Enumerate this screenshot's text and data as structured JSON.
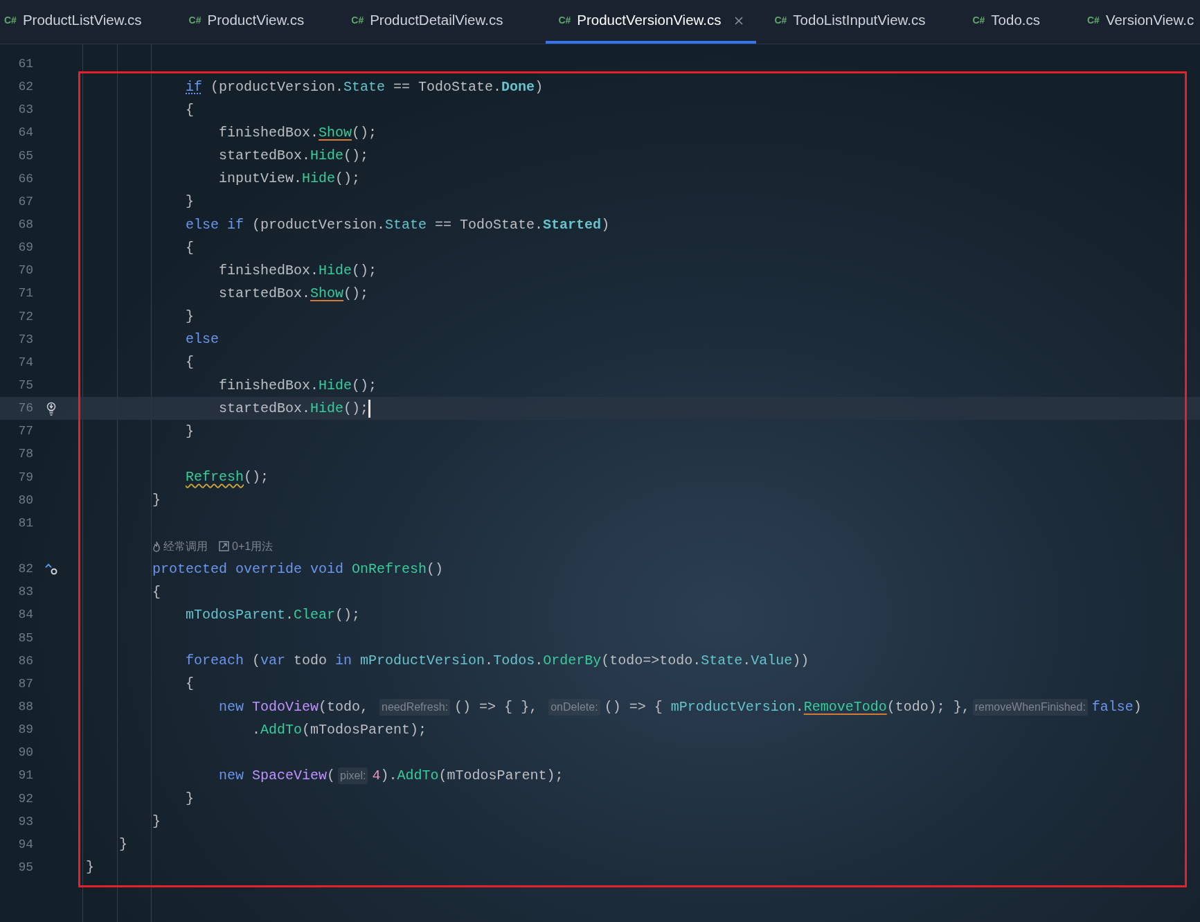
{
  "tabs": [
    {
      "lang": "C#",
      "label": "ProductListView.cs",
      "selected": false
    },
    {
      "lang": "C#",
      "label": "ProductView.cs",
      "selected": false
    },
    {
      "lang": "C#",
      "label": "ProductDetailView.cs",
      "selected": false
    },
    {
      "lang": "C#",
      "label": "ProductVersionView.cs",
      "selected": true
    },
    {
      "lang": "C#",
      "label": "TodoListInputView.cs",
      "selected": false
    },
    {
      "lang": "C#",
      "label": "Todo.cs",
      "selected": false
    },
    {
      "lang": "C#",
      "label": "VersionView.c",
      "selected": false
    }
  ],
  "annotation": {
    "kind": "rectangle"
  },
  "lines": [
    {
      "kind": "group",
      "children": [
        {
          "kind": "group",
          "children": [
            {
              "kind": "group",
              "children": [
                {
                  "kind": "code",
                  "number": "61",
                  "current": false,
                  "boxed": false
                },
                {
                  "kind": "code",
                  "number": "62",
                  "current": false,
                  "boxed": true,
                  "tokens": [
                    {
                      "kind": "keyword_dotted",
                      "text": "if"
                    },
                    {
                      "kind": "plain",
                      "text": " (productVersion."
                    },
                    {
                      "kind": "field",
                      "text": "State"
                    },
                    {
                      "kind": "plain",
                      "text": " == TodoState."
                    },
                    {
                      "kind": "enum",
                      "text": "Done"
                    },
                    {
                      "kind": "plain",
                      "text": ")"
                    }
                  ]
                },
                {
                  "kind": "code",
                  "number": "63",
                  "current": false,
                  "boxed": true,
                  "tokens": [
                    {
                      "kind": "plain",
                      "text": "{"
                    }
                  ],
                  "children": [
                    {
                      "kind": "code",
                      "number": "64",
                      "current": false,
                      "boxed": true,
                      "tokens": [
                        {
                          "kind": "plain",
                          "text": "finishedBox."
                        },
                        {
                          "kind": "method_underlined",
                          "text": "Show"
                        },
                        {
                          "kind": "plain",
                          "text": "();"
                        }
                      ]
                    },
                    {
                      "kind": "code",
                      "number": "65",
                      "current": false,
                      "boxed": true,
                      "tokens": [
                        {
                          "kind": "plain",
                          "text": "startedBox."
                        },
                        {
                          "kind": "method",
                          "text": "Hide"
                        },
                        {
                          "kind": "plain",
                          "text": "();"
                        }
                      ]
                    },
                    {
                      "kind": "code",
                      "number": "66",
                      "current": false,
                      "boxed": true,
                      "tokens": [
                        {
                          "kind": "plain",
                          "text": "inputView."
                        },
                        {
                          "kind": "method",
                          "text": "Hide"
                        },
                        {
                          "kind": "plain",
                          "text": "();"
                        }
                      ]
                    }
                  ]
                },
                {
                  "kind": "code",
                  "number": "67",
                  "current": false,
                  "boxed": true,
                  "tokens": [
                    {
                      "kind": "plain",
                      "text": "}"
                    }
                  ]
                },
                {
                  "kind": "code",
                  "number": "68",
                  "current": false,
                  "boxed": true,
                  "tokens": [
                    {
                      "kind": "keyword",
                      "text": "else if"
                    },
                    {
                      "kind": "plain",
                      "text": " (productVersion."
                    },
                    {
                      "kind": "field",
                      "text": "State"
                    },
                    {
                      "kind": "plain",
                      "text": " == TodoState."
                    },
                    {
                      "kind": "enum",
                      "text": "Started"
                    },
                    {
                      "kind": "plain",
                      "text": ")"
                    }
                  ]
                },
                {
                  "kind": "code",
                  "number": "69",
                  "current": false,
                  "boxed": true,
                  "tokens": [
                    {
                      "kind": "plain",
                      "text": "{"
                    }
                  ],
                  "children": [
                    {
                      "kind": "code",
                      "number": "70",
                      "current": false,
                      "boxed": true,
                      "tokens": [
                        {
                          "kind": "plain",
                          "text": "finishedBox."
                        },
                        {
                          "kind": "method",
                          "text": "Hide"
                        },
                        {
                          "kind": "plain",
                          "text": "();"
                        }
                      ]
                    },
                    {
                      "kind": "code",
                      "number": "71",
                      "current": false,
                      "boxed": true,
                      "tokens": [
                        {
                          "kind": "plain",
                          "text": "startedBox."
                        },
                        {
                          "kind": "method_underlined",
                          "text": "Show"
                        },
                        {
                          "kind": "plain",
                          "text": "();"
                        }
                      ]
                    }
                  ]
                },
                {
                  "kind": "code",
                  "number": "72",
                  "current": false,
                  "boxed": true,
                  "tokens": [
                    {
                      "kind": "plain",
                      "text": "}"
                    }
                  ]
                },
                {
                  "kind": "code",
                  "number": "73",
                  "current": false,
                  "boxed": true,
                  "tokens": [
                    {
                      "kind": "keyword",
                      "text": "else"
                    }
                  ]
                },
                {
                  "kind": "code",
                  "number": "74",
                  "current": false,
                  "boxed": true,
                  "tokens": [
                    {
                      "kind": "plain",
                      "text": "{"
                    }
                  ],
                  "children": [
                    {
                      "kind": "code",
                      "number": "75",
                      "current": false,
                      "boxed": true,
                      "tokens": [
                        {
                          "kind": "plain",
                          "text": "finishedBox."
                        },
                        {
                          "kind": "method",
                          "text": "Hide"
                        },
                        {
                          "kind": "plain",
                          "text": "();"
                        }
                      ]
                    },
                    {
                      "kind": "code",
                      "number": "76",
                      "current": true,
                      "boxed": true,
                      "gutter": {
                        "kind": "intention"
                      },
                      "tokens": [
                        {
                          "kind": "plain",
                          "text": "startedBox."
                        },
                        {
                          "kind": "method",
                          "text": "Hide"
                        },
                        {
                          "kind": "plain",
                          "text": "();"
                        }
                      ]
                    }
                  ]
                },
                {
                  "kind": "code",
                  "number": "77",
                  "current": false,
                  "boxed": true,
                  "tokens": [
                    {
                      "kind": "plain",
                      "text": "}"
                    }
                  ]
                },
                {
                  "kind": "code",
                  "number": "78",
                  "current": false,
                  "boxed": true
                },
                {
                  "kind": "code",
                  "number": "79",
                  "current": false,
                  "boxed": true,
                  "tokens": [
                    {
                      "kind": "method_wavy",
                      "text": "Refresh"
                    },
                    {
                      "kind": "plain",
                      "text": "();"
                    }
                  ]
                }
              ]
            },
            {
              "kind": "code",
              "number": "80",
              "current": false,
              "boxed": true,
              "tokens": [
                {
                  "kind": "plain",
                  "text": "}"
                }
              ]
            },
            {
              "kind": "code",
              "number": "81",
              "current": false,
              "boxed": true
            },
            {
              "kind": "lens",
              "current": false,
              "boxed": true,
              "items": [
                {
                  "kind": "frequent",
                  "text": "经常调用"
                },
                {
                  "kind": "usages",
                  "text": "0+1用法"
                }
              ]
            },
            {
              "kind": "code",
              "number": "82",
              "current": false,
              "boxed": true,
              "gutter": {
                "kind": "override"
              },
              "tokens": [
                {
                  "kind": "keyword",
                  "text": "protected override void "
                },
                {
                  "kind": "method",
                  "text": "OnRefresh"
                },
                {
                  "kind": "plain",
                  "text": "()"
                }
              ]
            },
            {
              "kind": "code",
              "number": "83",
              "current": false,
              "boxed": true,
              "tokens": [
                {
                  "kind": "plain",
                  "text": "{"
                }
              ]
            },
            {
              "kind": "group",
              "children": [
                {
                  "kind": "code",
                  "number": "84",
                  "current": false,
                  "boxed": true,
                  "tokens": [
                    {
                      "kind": "field",
                      "text": "mTodosParent"
                    },
                    {
                      "kind": "plain",
                      "text": "."
                    },
                    {
                      "kind": "method",
                      "text": "Clear"
                    },
                    {
                      "kind": "plain",
                      "text": "();"
                    }
                  ]
                },
                {
                  "kind": "code",
                  "number": "85",
                  "current": false,
                  "boxed": true
                },
                {
                  "kind": "code",
                  "number": "86",
                  "current": false,
                  "boxed": true,
                  "tokens": [
                    {
                      "kind": "keyword",
                      "text": "foreach"
                    },
                    {
                      "kind": "plain",
                      "text": " ("
                    },
                    {
                      "kind": "keyword",
                      "text": "var"
                    },
                    {
                      "kind": "plain",
                      "text": " todo "
                    },
                    {
                      "kind": "keyword",
                      "text": "in "
                    },
                    {
                      "kind": "field",
                      "text": "mProductVersion"
                    },
                    {
                      "kind": "plain",
                      "text": "."
                    },
                    {
                      "kind": "field",
                      "text": "Todos"
                    },
                    {
                      "kind": "plain",
                      "text": "."
                    },
                    {
                      "kind": "method",
                      "text": "OrderBy"
                    },
                    {
                      "kind": "plain",
                      "text": "(todo=>todo."
                    },
                    {
                      "kind": "field",
                      "text": "State"
                    },
                    {
                      "kind": "plain",
                      "text": "."
                    },
                    {
                      "kind": "field",
                      "text": "Value"
                    },
                    {
                      "kind": "plain",
                      "text": "))"
                    }
                  ]
                },
                {
                  "kind": "code",
                  "number": "87",
                  "current": false,
                  "boxed": true,
                  "tokens": [
                    {
                      "kind": "plain",
                      "text": "{"
                    }
                  ],
                  "children": [
                    {
                      "kind": "code",
                      "number": "88",
                      "current": false,
                      "boxed": true,
                      "tokens": [
                        {
                          "kind": "keyword",
                          "text": "new "
                        },
                        {
                          "kind": "type",
                          "text": "TodoView"
                        },
                        {
                          "kind": "plain",
                          "text": "(todo, "
                        },
                        {
                          "kind": "hint",
                          "text": "needRefresh:"
                        },
                        {
                          "kind": "plain",
                          "text": "() => { }, "
                        },
                        {
                          "kind": "hint",
                          "text": "onDelete:"
                        },
                        {
                          "kind": "plain",
                          "text": "() => { "
                        },
                        {
                          "kind": "field",
                          "text": "mProductVersion"
                        },
                        {
                          "kind": "plain",
                          "text": "."
                        },
                        {
                          "kind": "method_underlined",
                          "text": "RemoveTodo"
                        },
                        {
                          "kind": "plain",
                          "text": "(todo); },"
                        },
                        {
                          "kind": "hint",
                          "text": "removeWhenFinished:"
                        },
                        {
                          "kind": "keyword",
                          "text": "false"
                        },
                        {
                          "kind": "plain",
                          "text": ")"
                        }
                      ],
                      "children": [
                        {
                          "kind": "code",
                          "number": "89",
                          "current": false,
                          "boxed": true,
                          "tokens": [
                            {
                              "kind": "plain",
                              "text": "."
                            },
                            {
                              "kind": "method",
                              "text": "AddTo"
                            },
                            {
                              "kind": "plain",
                              "text": "(mTodosParent);"
                            }
                          ]
                        }
                      ]
                    },
                    {
                      "kind": "code",
                      "number": "90",
                      "current": false,
                      "boxed": true
                    },
                    {
                      "kind": "code",
                      "number": "91",
                      "current": false,
                      "boxed": true,
                      "tokens": [
                        {
                          "kind": "keyword",
                          "text": "new "
                        },
                        {
                          "kind": "type",
                          "text": "SpaceView"
                        },
                        {
                          "kind": "plain",
                          "text": "("
                        },
                        {
                          "kind": "hint",
                          "text": "pixel:"
                        },
                        {
                          "kind": "number",
                          "text": "4"
                        },
                        {
                          "kind": "plain",
                          "text": ")."
                        },
                        {
                          "kind": "method",
                          "text": "AddTo"
                        },
                        {
                          "kind": "plain",
                          "text": "(mTodosParent);"
                        }
                      ]
                    }
                  ]
                },
                {
                  "kind": "code",
                  "number": "92",
                  "current": false,
                  "boxed": true,
                  "tokens": [
                    {
                      "kind": "plain",
                      "text": "}"
                    }
                  ]
                }
              ]
            },
            {
              "kind": "code",
              "number": "93",
              "current": false,
              "boxed": true,
              "tokens": [
                {
                  "kind": "plain",
                  "text": "}"
                }
              ]
            }
          ]
        },
        {
          "kind": "code",
          "number": "94",
          "current": false,
          "boxed": true,
          "tokens": [
            {
              "kind": "plain",
              "text": "}"
            }
          ]
        }
      ]
    },
    {
      "kind": "code",
      "number": "95",
      "current": false,
      "boxed": true,
      "tokens": [
        {
          "kind": "plain",
          "text": "}"
        }
      ]
    }
  ]
}
